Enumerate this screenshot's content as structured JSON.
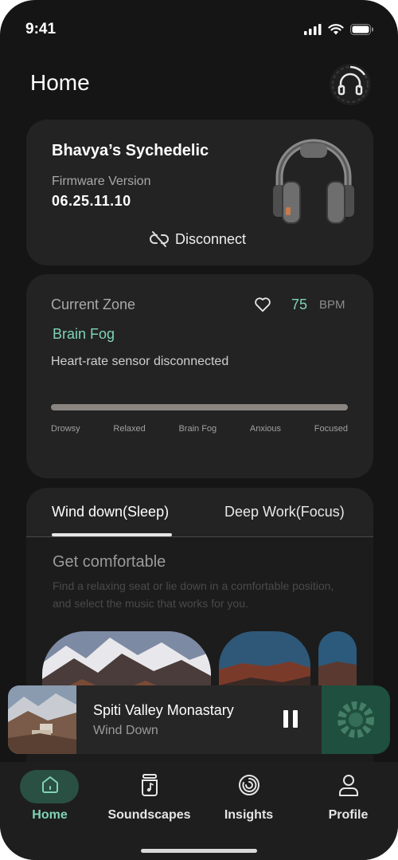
{
  "status_bar": {
    "time": "9:41"
  },
  "header": {
    "title": "Home",
    "headphone_icon": "headphone-icon"
  },
  "device": {
    "name": "Bhavya’s Sychedelic",
    "firmware_label": "Firmware Version",
    "firmware_value": "06.25.11.10",
    "disconnect_label": "Disconnect"
  },
  "zone": {
    "label": "Current Zone",
    "bpm_value": "75",
    "bpm_unit": "BPM",
    "current": "Brain Fog",
    "sensor_status": "Heart-rate sensor disconnected",
    "scale": [
      "Drowsy",
      "Relaxed",
      "Brain Fog",
      "Anxious",
      "Focused"
    ]
  },
  "tabs": {
    "items": [
      {
        "label": "Wind down(Sleep)",
        "active": true
      },
      {
        "label": "Deep Work(Focus)",
        "active": false
      }
    ],
    "step_title": "Get comfortable",
    "step_desc": "Find a relaxing seat or lie down in a comfortable position, and select the music that works for you."
  },
  "player": {
    "title": "Spiti Valley Monastary",
    "subtitle": "Wind Down"
  },
  "nav": {
    "items": [
      {
        "label": "Home",
        "icon": "home-icon",
        "active": true
      },
      {
        "label": "Soundscapes",
        "icon": "jar-music-icon",
        "active": false
      },
      {
        "label": "Insights",
        "icon": "insights-ring-icon",
        "active": false
      },
      {
        "label": "Profile",
        "icon": "person-icon",
        "active": false
      }
    ]
  },
  "colors": {
    "accent": "#7fd3b6",
    "background": "#151515",
    "card": "#232323",
    "nav_active_pill": "#2a4f43"
  }
}
